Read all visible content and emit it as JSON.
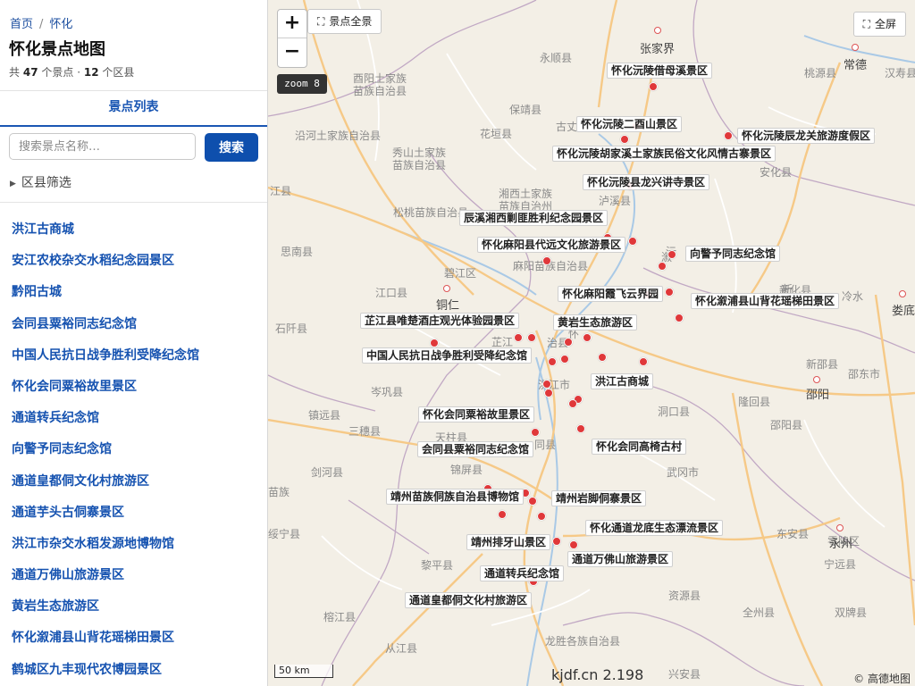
{
  "breadcrumb": {
    "home": "首页",
    "separator": "/",
    "current": "怀化"
  },
  "title": "怀化景点地图",
  "summary": {
    "prefix": "共",
    "spots": "47",
    "mid": "个景点 ·",
    "counties": "12",
    "suffix": "个区县"
  },
  "tab_label": "景点列表",
  "search": {
    "placeholder": "搜索景点名称…",
    "button": "搜索"
  },
  "filter_label": "区县筛选",
  "spot_list": [
    "洪江古商城",
    "安江农校杂交水稻纪念园景区",
    "黔阳古城",
    "会同县粟裕同志纪念馆",
    "中国人民抗日战争胜利受降纪念馆",
    "怀化会同粟裕故里景区",
    "通道转兵纪念馆",
    "向警予同志纪念馆",
    "通道皇都侗文化村旅游区",
    "通道芋头古侗寨景区",
    "洪江市杂交水稻发源地博物馆",
    "通道万佛山旅游景区",
    "黄岩生态旅游区",
    "怀化溆浦县山背花瑶梯田景区",
    "鹤城区九丰现代农博园景区"
  ],
  "map": {
    "zoom_in": "+",
    "zoom_out": "−",
    "overview_button": "景点全景",
    "fullscreen_button": "全屏",
    "zoom_badge": "zoom 8",
    "scale_label": "50 km",
    "watermark": "kjdf.cn 2.198",
    "attribution": "© 高德地图",
    "colors": {
      "marker": "#e0383a",
      "road_major": "#f6c987",
      "boundary": "#b9a3b9",
      "water": "#a9c9e6"
    },
    "icons": {
      "expand": "expand-icon",
      "filter_toggle": "triangle-right-icon"
    },
    "cities": [
      "张家界",
      "常德",
      "铜仁",
      "娄底",
      "邵阳",
      "永州"
    ],
    "places": [
      "酉阳土家族",
      "苗族自治县",
      "永顺县",
      "桃源县",
      "汉寿县",
      "保靖县",
      "古丈",
      "花垣县",
      "沿河土家族自治县",
      "秀山土家族",
      "苗族自治县",
      "湘西土家族",
      "苗族自治州",
      "松桃苗族自治县",
      "泸溪县",
      "安化县",
      "江县",
      "思南县",
      "碧江区",
      "麻阳苗族自治县",
      "溆",
      "江口县",
      "石阡县",
      "芷江",
      "治县",
      "新化县",
      "冷水",
      "新邵县",
      "邵东市",
      "洪江市",
      "洞口县",
      "隆回县",
      "岑巩县",
      "镇远县",
      "三穗县",
      "天柱县",
      "同县",
      "邵阳县",
      "剑河县",
      "锦屏县",
      "武冈市",
      "苗族",
      "绥宁县",
      "东安县",
      "黎平县",
      "资源县",
      "全州县",
      "双牌县",
      "宁远县",
      "零陵区",
      "榕江县",
      "龙胜各族自治县",
      "从江县",
      "兴安县",
      "新",
      "沅",
      "怀"
    ],
    "markers": [
      {
        "label": "怀化沅陵借母溪景区"
      },
      {
        "label": "怀化沅陵二酉山景区"
      },
      {
        "label": "怀化沅陵胡家溪土家族民俗文化风情古寨景区"
      },
      {
        "label": "怀化沅陵辰龙关旅游度假区"
      },
      {
        "label": "怀化沅陵县龙兴讲寺景区"
      },
      {
        "label": "辰溪湘西剿匪胜利纪念园景区"
      },
      {
        "label": "怀化麻阳县代远文化旅游景区"
      },
      {
        "label": "向警予同志纪念馆"
      },
      {
        "label": "怀化麻阳霞飞云界园"
      },
      {
        "label": "怀化溆浦县山背花瑶梯田景区"
      },
      {
        "label": "芷江县唯楚酒庄观光体验园景区"
      },
      {
        "label": "黄岩生态旅游区"
      },
      {
        "label": "中国人民抗日战争胜利受降纪念馆"
      },
      {
        "label": "洪江古商城"
      },
      {
        "label": "怀化会同粟裕故里景区"
      },
      {
        "label": "会同县粟裕同志纪念馆"
      },
      {
        "label": "怀化会同高椅古村"
      },
      {
        "label": "靖州苗族侗族自治县博物馆"
      },
      {
        "label": "靖州岩脚侗寨景区"
      },
      {
        "label": "怀化通道龙底生态漂流景区"
      },
      {
        "label": "靖州排牙山景区"
      },
      {
        "label": "通道万佛山旅游景区"
      },
      {
        "label": "通道转兵纪念馆"
      },
      {
        "label": "通道皇都侗文化村旅游区"
      }
    ]
  }
}
